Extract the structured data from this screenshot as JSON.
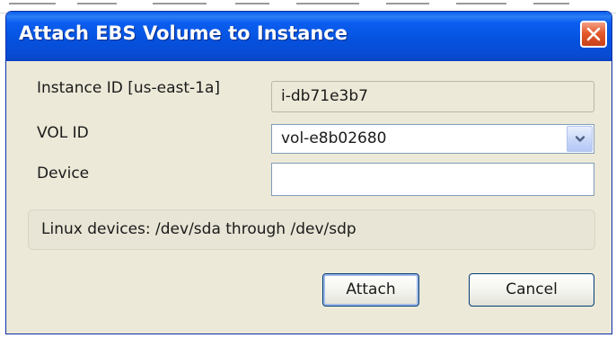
{
  "dialog": {
    "title": "Attach EBS Volume to Instance",
    "close_icon": "close-icon"
  },
  "form": {
    "instance_label": "Instance ID [us-east-1a]",
    "instance_value": "i-db71e3b7",
    "volume_label": "VOL ID",
    "volume_selected": "vol-e8b02680",
    "volume_dropdown_icon": "chevron-down-icon",
    "device_label": "Device",
    "device_value": ""
  },
  "info": {
    "text": "Linux devices: /dev/sda through /dev/sdp"
  },
  "buttons": {
    "attach_label": "Attach",
    "cancel_label": "Cancel"
  },
  "colors": {
    "titlebar": "#0551dd",
    "dialog_bg": "#ece9d8",
    "close_button": "#e35a2a",
    "default_button_border": "#003c74"
  }
}
